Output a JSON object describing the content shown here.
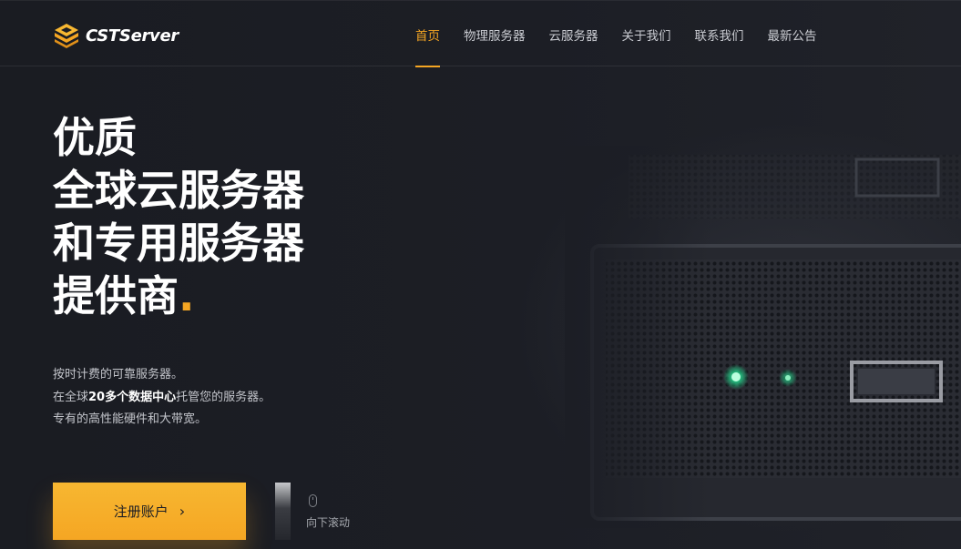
{
  "brand": {
    "name": "CSTServer",
    "logo_icon": "layered-cube-logo-icon",
    "accent_color": "#f5a623"
  },
  "nav": {
    "items": [
      {
        "label": "首页",
        "active": true
      },
      {
        "label": "物理服务器",
        "active": false
      },
      {
        "label": "云服务器",
        "active": false
      },
      {
        "label": "关于我们",
        "active": false
      },
      {
        "label": "联系我们",
        "active": false
      },
      {
        "label": "最新公告",
        "active": false
      }
    ]
  },
  "hero": {
    "headline": {
      "line1": "优质",
      "line2": "全球云服务器",
      "line3": "和专用服务器",
      "line4": "提供商",
      "accent_dot": "."
    },
    "description": {
      "line1": "按时计费的可靠服务器。",
      "line2_prefix": "在全球",
      "line2_highlight": "20多个数据中心",
      "line2_suffix": "托管您的服务器。",
      "line3": "专有的高性能硬件和大带宽。"
    },
    "cta": {
      "label": "注册账户",
      "icon": "chevron-right-icon"
    },
    "scroll": {
      "label": "向下滚动",
      "icon": "mouse-icon"
    }
  }
}
